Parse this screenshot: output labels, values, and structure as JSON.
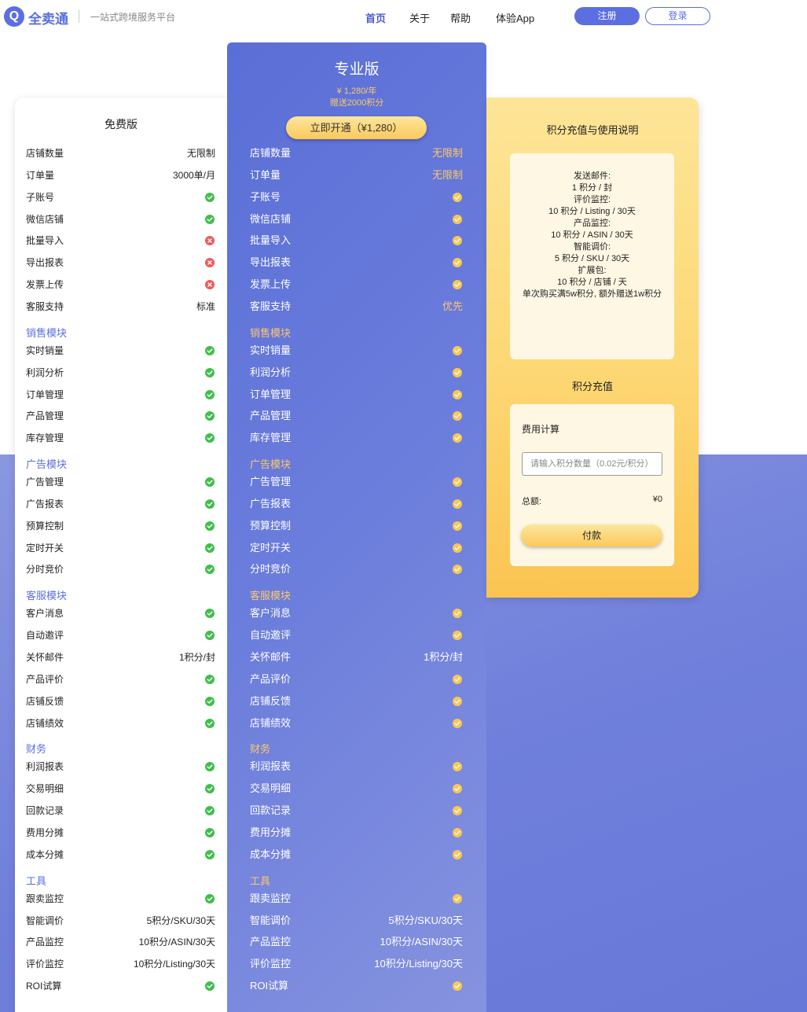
{
  "header": {
    "logo_mark": "Q",
    "logo_text": "全卖通",
    "slogan": "一站式跨境服务平台",
    "nav": [
      "首页",
      "关于",
      "帮助",
      "体验App"
    ],
    "register": "注册",
    "login": "登录"
  },
  "colors": {
    "brand": "#5b6fe0",
    "gold": "#fcc76d",
    "check_green": "#3fbf4a",
    "cross_red": "#ef5a5a"
  },
  "free": {
    "title": "免费版",
    "items": [
      {
        "type": "row",
        "label": "店铺数量",
        "value": "无限制"
      },
      {
        "type": "row",
        "label": "订单量",
        "value": "3000单/月"
      },
      {
        "type": "row",
        "label": "子账号",
        "icon": "check"
      },
      {
        "type": "row",
        "label": "微信店铺",
        "icon": "check"
      },
      {
        "type": "row",
        "label": "批量导入",
        "icon": "cross"
      },
      {
        "type": "row",
        "label": "导出报表",
        "icon": "cross"
      },
      {
        "type": "row",
        "label": "发票上传",
        "icon": "cross"
      },
      {
        "type": "row",
        "label": "客服支持",
        "value": "标准"
      },
      {
        "type": "section",
        "label": "销售模块"
      },
      {
        "type": "row",
        "label": "实时销量",
        "icon": "check"
      },
      {
        "type": "row",
        "label": "利润分析",
        "icon": "check"
      },
      {
        "type": "row",
        "label": "订单管理",
        "icon": "check"
      },
      {
        "type": "row",
        "label": "产品管理",
        "icon": "check"
      },
      {
        "type": "row",
        "label": "库存管理",
        "icon": "check"
      },
      {
        "type": "section",
        "label": "广告模块"
      },
      {
        "type": "row",
        "label": "广告管理",
        "icon": "check"
      },
      {
        "type": "row",
        "label": "广告报表",
        "icon": "check"
      },
      {
        "type": "row",
        "label": "预算控制",
        "icon": "check"
      },
      {
        "type": "row",
        "label": "定时开关",
        "icon": "check"
      },
      {
        "type": "row",
        "label": "分时竞价",
        "icon": "check"
      },
      {
        "type": "section",
        "label": "客服模块"
      },
      {
        "type": "row",
        "label": "客户消息",
        "icon": "check"
      },
      {
        "type": "row",
        "label": "自动邀评",
        "icon": "check"
      },
      {
        "type": "row",
        "label": "关怀邮件",
        "value": "1积分/封"
      },
      {
        "type": "row",
        "label": "产品评价",
        "icon": "check"
      },
      {
        "type": "row",
        "label": "店铺反馈",
        "icon": "check"
      },
      {
        "type": "row",
        "label": "店铺绩效",
        "icon": "check"
      },
      {
        "type": "section",
        "label": "财务"
      },
      {
        "type": "row",
        "label": "利润报表",
        "icon": "check"
      },
      {
        "type": "row",
        "label": "交易明细",
        "icon": "check"
      },
      {
        "type": "row",
        "label": "回款记录",
        "icon": "check"
      },
      {
        "type": "row",
        "label": "费用分摊",
        "icon": "check"
      },
      {
        "type": "row",
        "label": "成本分摊",
        "icon": "check"
      },
      {
        "type": "section",
        "label": "工具"
      },
      {
        "type": "row",
        "label": "跟卖监控",
        "icon": "check"
      },
      {
        "type": "row",
        "label": "智能调价",
        "value": "5积分/SKU/30天"
      },
      {
        "type": "row",
        "label": "产品监控",
        "value": "10积分/ASIN/30天"
      },
      {
        "type": "row",
        "label": "评价监控",
        "value": "10积分/Listing/30天"
      },
      {
        "type": "row",
        "label": "ROI试算",
        "icon": "check"
      }
    ]
  },
  "pro": {
    "title": "专业版",
    "price": "¥ 1,280/年",
    "bonus": "赠送2000积分",
    "cta": "立即开通（¥1,280）",
    "items": [
      {
        "type": "row",
        "label": "店铺数量",
        "value": "无限制",
        "gold": true
      },
      {
        "type": "row",
        "label": "订单量",
        "value": "无限制",
        "gold": true
      },
      {
        "type": "row",
        "label": "子账号",
        "icon": "check"
      },
      {
        "type": "row",
        "label": "微信店铺",
        "icon": "check"
      },
      {
        "type": "row",
        "label": "批量导入",
        "icon": "check"
      },
      {
        "type": "row",
        "label": "导出报表",
        "icon": "check"
      },
      {
        "type": "row",
        "label": "发票上传",
        "icon": "check"
      },
      {
        "type": "row",
        "label": "客服支持",
        "value": "优先",
        "gold": true
      },
      {
        "type": "section",
        "label": "销售模块"
      },
      {
        "type": "row",
        "label": "实时销量",
        "icon": "check"
      },
      {
        "type": "row",
        "label": "利润分析",
        "icon": "check"
      },
      {
        "type": "row",
        "label": "订单管理",
        "icon": "check"
      },
      {
        "type": "row",
        "label": "产品管理",
        "icon": "check"
      },
      {
        "type": "row",
        "label": "库存管理",
        "icon": "check"
      },
      {
        "type": "section",
        "label": "广告模块"
      },
      {
        "type": "row",
        "label": "广告管理",
        "icon": "check"
      },
      {
        "type": "row",
        "label": "广告报表",
        "icon": "check"
      },
      {
        "type": "row",
        "label": "预算控制",
        "icon": "check"
      },
      {
        "type": "row",
        "label": "定时开关",
        "icon": "check"
      },
      {
        "type": "row",
        "label": "分时竞价",
        "icon": "check"
      },
      {
        "type": "section",
        "label": "客服模块"
      },
      {
        "type": "row",
        "label": "客户消息",
        "icon": "check"
      },
      {
        "type": "row",
        "label": "自动邀评",
        "icon": "check"
      },
      {
        "type": "row",
        "label": "关怀邮件",
        "value": "1积分/封"
      },
      {
        "type": "row",
        "label": "产品评价",
        "icon": "check"
      },
      {
        "type": "row",
        "label": "店铺反馈",
        "icon": "check"
      },
      {
        "type": "row",
        "label": "店铺绩效",
        "icon": "check"
      },
      {
        "type": "section",
        "label": "财务"
      },
      {
        "type": "row",
        "label": "利润报表",
        "icon": "check"
      },
      {
        "type": "row",
        "label": "交易明细",
        "icon": "check"
      },
      {
        "type": "row",
        "label": "回款记录",
        "icon": "check"
      },
      {
        "type": "row",
        "label": "费用分摊",
        "icon": "check"
      },
      {
        "type": "row",
        "label": "成本分摊",
        "icon": "check"
      },
      {
        "type": "section",
        "label": "工具"
      },
      {
        "type": "row",
        "label": "跟卖监控",
        "icon": "check"
      },
      {
        "type": "row",
        "label": "智能调价",
        "value": "5积分/SKU/30天"
      },
      {
        "type": "row",
        "label": "产品监控",
        "value": "10积分/ASIN/30天"
      },
      {
        "type": "row",
        "label": "评价监控",
        "value": "10积分/Listing/30天"
      },
      {
        "type": "row",
        "label": "ROI试算",
        "icon": "check"
      }
    ]
  },
  "points": {
    "title": "积分充值与使用说明",
    "info_lines": [
      "发送邮件:",
      "1 积分 / 封",
      "评价监控:",
      "10 积分 / Listing / 30天",
      "产品监控:",
      "10 积分 / ASIN / 30天",
      "智能调价:",
      "5 积分 / SKU / 30天",
      "扩展包:",
      "10 积分 / 店铺 / 天",
      "单次购买满5w积分, 额外赠送1w积分"
    ],
    "recharge_title": "积分充值",
    "calc_label": "费用计算",
    "input_placeholder": "请输入积分数量（0.02元/积分）",
    "total_label": "总额:",
    "total_value": "¥0",
    "pay_button": "付款"
  }
}
